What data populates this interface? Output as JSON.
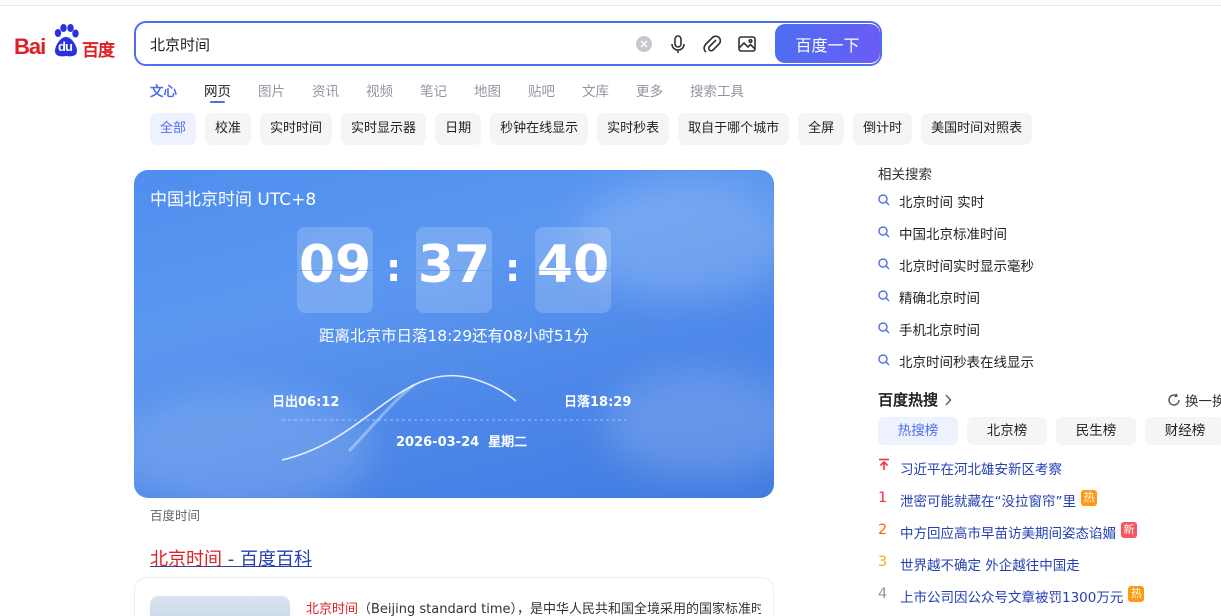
{
  "logo": {
    "text_latin": "Bai",
    "text_paw": "du",
    "text_cn": "百度"
  },
  "search": {
    "query": "北京时间",
    "button_label": "百度一下"
  },
  "tabs": [
    {
      "label": "文心"
    },
    {
      "label": "网页"
    },
    {
      "label": "图片"
    },
    {
      "label": "资讯"
    },
    {
      "label": "视频"
    },
    {
      "label": "笔记"
    },
    {
      "label": "地图"
    },
    {
      "label": "贴吧"
    },
    {
      "label": "文库"
    },
    {
      "label": "更多"
    },
    {
      "label": "搜索工具"
    }
  ],
  "chips": [
    {
      "label": "全部"
    },
    {
      "label": "校准"
    },
    {
      "label": "实时时间"
    },
    {
      "label": "实时显示器"
    },
    {
      "label": "日期"
    },
    {
      "label": "秒钟在线显示"
    },
    {
      "label": "实时秒表"
    },
    {
      "label": "取自于哪个城市"
    },
    {
      "label": "全屏"
    },
    {
      "label": "倒计时"
    },
    {
      "label": "美国时间对照表"
    }
  ],
  "time_card": {
    "title": "中国北京时间 UTC+8",
    "hours": "09",
    "minutes": "37",
    "seconds": "40",
    "sunset_note": "距离北京市日落18:29还有08小时51分",
    "sunrise": "日出06:12",
    "sunset": "日落18:29",
    "date": "2026-03-24",
    "weekday": "星期二",
    "source": "百度时间"
  },
  "result": {
    "title_highlight": "北京时间",
    "title_rest": " - 百度百科",
    "snippet_highlight": "北京时间",
    "snippet_rest": "（Beijing standard time），是中华人民共和国全境采用的国家标准时"
  },
  "related": {
    "title": "相关搜索",
    "items": [
      {
        "label": "北京时间 实时"
      },
      {
        "label": "中国北京标准时间"
      },
      {
        "label": "北京时间实时显示毫秒"
      },
      {
        "label": "精确北京时间"
      },
      {
        "label": "手机北京时间"
      },
      {
        "label": "北京时间秒表在线显示"
      }
    ]
  },
  "hot": {
    "title": "百度热搜",
    "refresh_label": "换一换",
    "tabs": [
      {
        "label": "热搜榜"
      },
      {
        "label": "北京榜"
      },
      {
        "label": "民生榜"
      },
      {
        "label": "财经榜"
      }
    ],
    "items": [
      {
        "rank": "",
        "text": "习近平在河北雄安新区考察",
        "badge": ""
      },
      {
        "rank": "1",
        "text": "泄密可能就藏在“没拉窗帘”里",
        "badge": "热"
      },
      {
        "rank": "2",
        "text": "中方回应高市早苗访美期间姿态谄媚",
        "badge": "新"
      },
      {
        "rank": "3",
        "text": "世界越不确定 外企越往中国走",
        "badge": ""
      },
      {
        "rank": "4",
        "text": "上市公司因公众号文章被罚1300万元",
        "badge": "热"
      }
    ],
    "colors": {
      "rank1": "#fe2d46",
      "rank2": "#f60",
      "rank3": "#faa90e",
      "rank_other": "#9195a3"
    }
  }
}
